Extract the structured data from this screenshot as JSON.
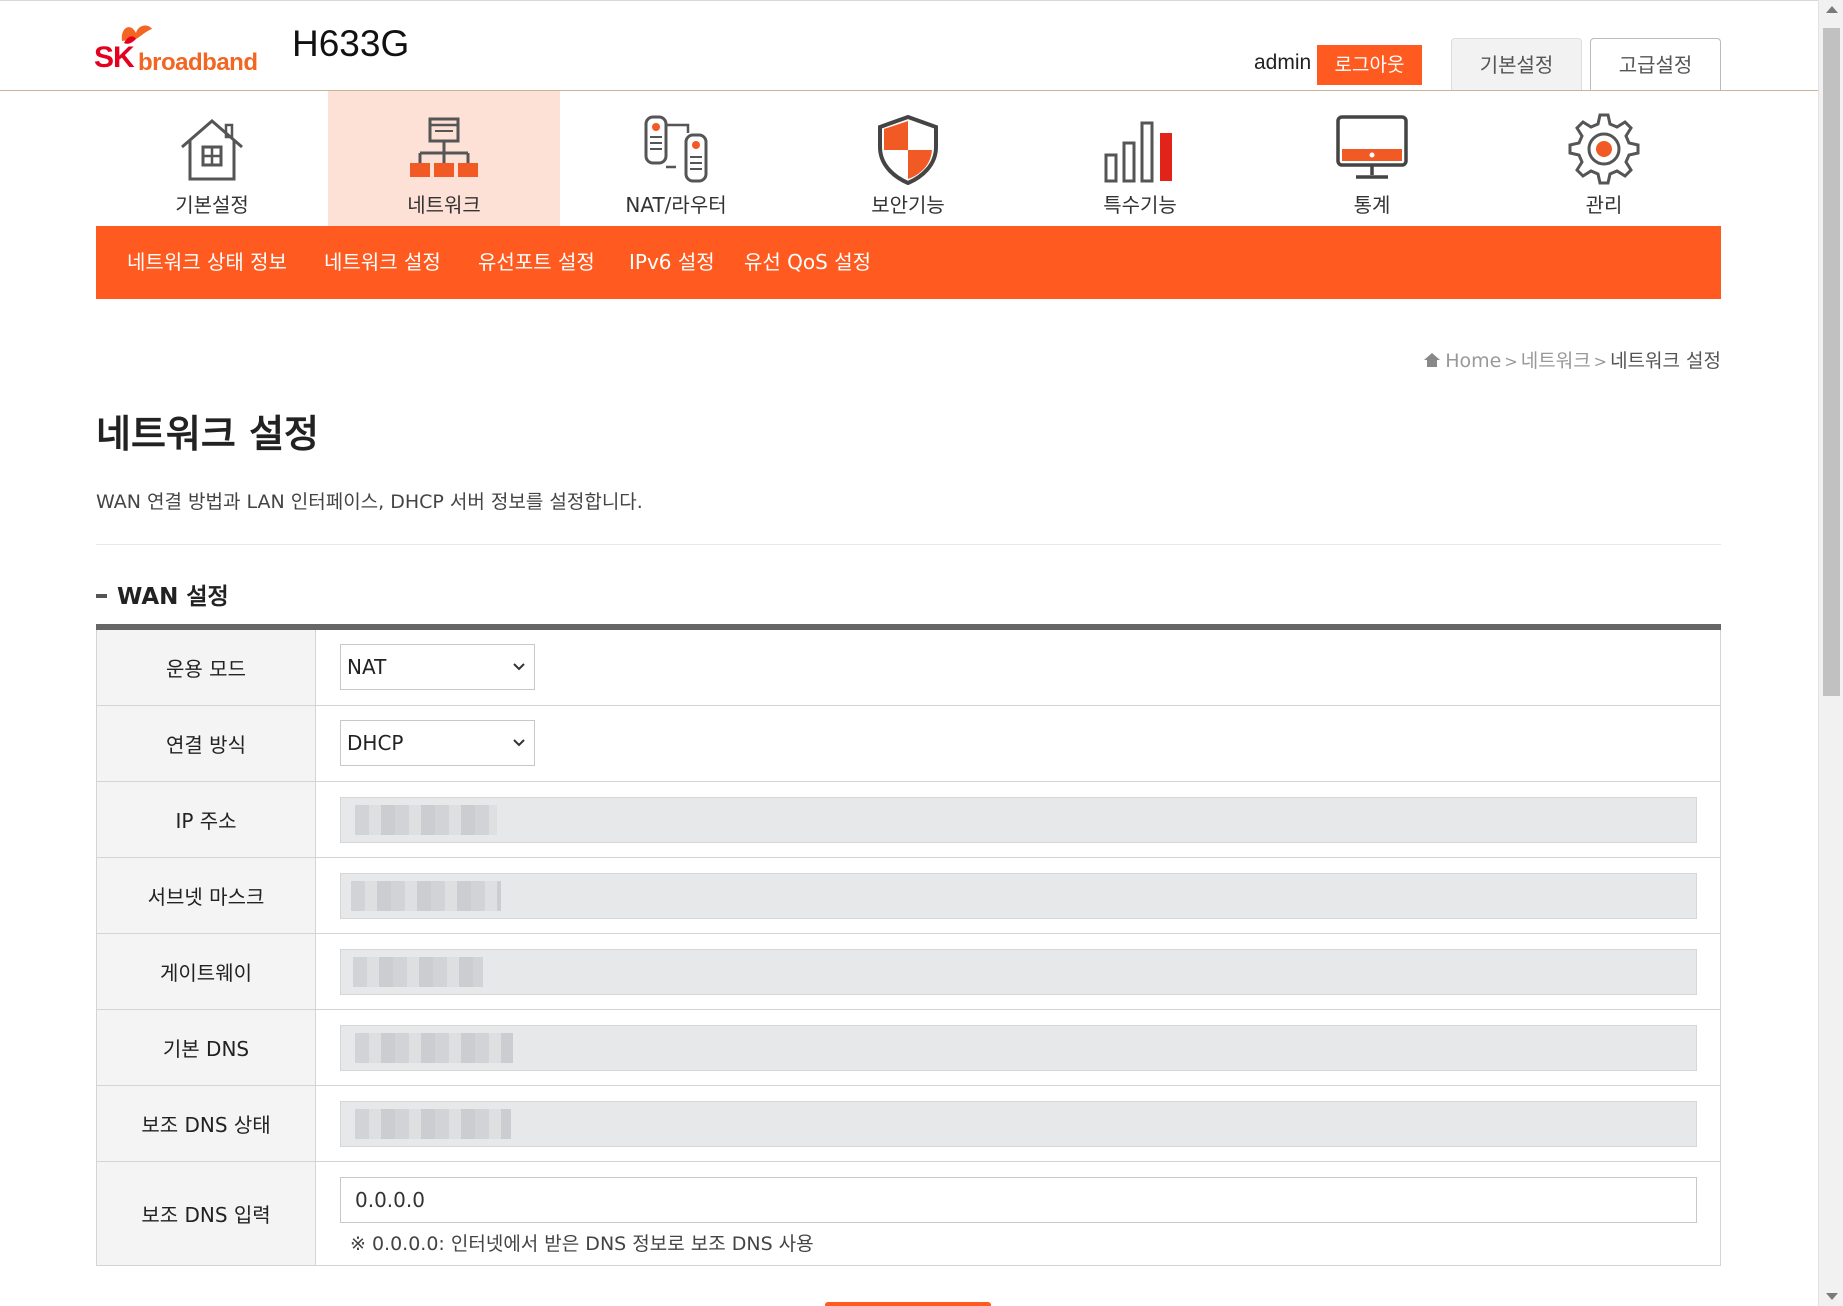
{
  "header": {
    "brand_sk": "SK",
    "brand_broadband": "broadband",
    "model": "H633G",
    "user": "admin",
    "logout_label": "로그아웃",
    "tabs": [
      {
        "label": "기본설정"
      },
      {
        "label": "고급설정"
      }
    ]
  },
  "icon_nav": [
    {
      "label": "기본설정",
      "icon": "home-icon"
    },
    {
      "label": "네트워크",
      "icon": "network-icon",
      "active": true
    },
    {
      "label": "NAT/라우터",
      "icon": "router-icon"
    },
    {
      "label": "보안기능",
      "icon": "shield-icon"
    },
    {
      "label": "특수기능",
      "icon": "bars-icon"
    },
    {
      "label": "통계",
      "icon": "monitor-icon"
    },
    {
      "label": "관리",
      "icon": "gear-icon"
    }
  ],
  "sub_nav": [
    {
      "label": "네트워크 상태 정보"
    },
    {
      "label": "네트워크 설정"
    },
    {
      "label": "유선포트 설정"
    },
    {
      "label": "IPv6 설정"
    },
    {
      "label": "유선 QoS 설정"
    }
  ],
  "breadcrumb": {
    "home": "Home",
    "level1": "네트워크",
    "current": "네트워크 설정",
    "separator": ">"
  },
  "page": {
    "title": "네트워크 설정",
    "description": "WAN 연결 방법과 LAN 인터페이스, DHCP 서버 정보를 설정합니다."
  },
  "wan": {
    "section_title": "WAN 설정",
    "rows": {
      "mode": {
        "label": "운용 모드",
        "value": "NAT"
      },
      "conn": {
        "label": "연결 방식",
        "value": "DHCP"
      },
      "ip": {
        "label": "IP 주소"
      },
      "subnet": {
        "label": "서브넷 마스크"
      },
      "gateway": {
        "label": "게이트웨이"
      },
      "dns1": {
        "label": "기본 DNS"
      },
      "dns2_status": {
        "label": "보조 DNS 상태"
      },
      "dns2_input": {
        "label": "보조 DNS 입력",
        "value": "0.0.0.0",
        "note": "※ 0.0.0.0: 인터넷에서 받은 DNS 정보로 보조 DNS 사용"
      }
    }
  },
  "colors": {
    "accent": "#ff5a1f",
    "active_tab_bg": "#fde1d6",
    "header_gray": "#f4f4f4",
    "brand_red": "#e4001e"
  }
}
